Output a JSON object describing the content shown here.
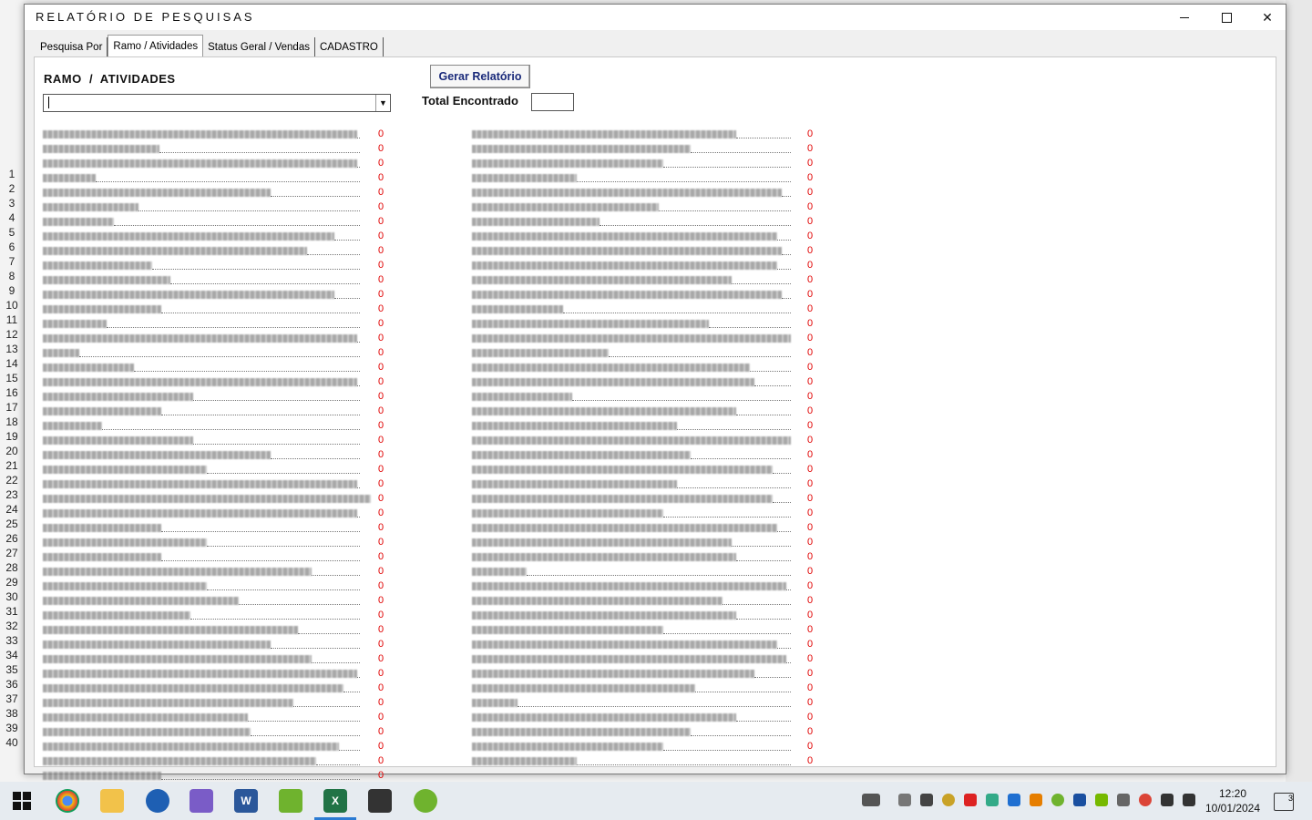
{
  "window": {
    "title": "RELATÓRIO DE PESQUISAS",
    "minimize": "—",
    "maximize": "☐",
    "close": "✕"
  },
  "tabs": [
    {
      "label": "Pesquisa Por",
      "active": false
    },
    {
      "label": "Ramo / Atividades",
      "active": true
    },
    {
      "label": "Status Geral / Vendas",
      "active": false
    },
    {
      "label": "CADASTRO",
      "active": false
    }
  ],
  "panel": {
    "heading": "RAMO  /  ATIVIDADES",
    "combo_value": "",
    "generate_button": "Gerar Relatório",
    "total_label": "Total Encontrado",
    "total_value": ""
  },
  "left_counts": [
    "0",
    "0",
    "0",
    "0",
    "0",
    "0",
    "0",
    "0",
    "0",
    "0",
    "0",
    "0",
    "0",
    "0",
    "0",
    "0",
    "0",
    "0",
    "0",
    "0",
    "0",
    "0",
    "0",
    "0",
    "0",
    "0",
    "0",
    "0",
    "0",
    "0",
    "0",
    "0",
    "0",
    "0",
    "0",
    "0",
    "0",
    "0",
    "0",
    "0",
    "0",
    "0",
    "0",
    "0",
    "0"
  ],
  "right_counts": [
    "0",
    "0",
    "0",
    "0",
    "0",
    "0",
    "0",
    "0",
    "0",
    "0",
    "0",
    "0",
    "0",
    "0",
    "0",
    "0",
    "0",
    "0",
    "0",
    "0",
    "0",
    "0",
    "0",
    "0",
    "0",
    "0",
    "0",
    "0",
    "0",
    "0",
    "0",
    "0",
    "0",
    "0",
    "0",
    "0",
    "0",
    "0",
    "0",
    "0",
    "0",
    "0",
    "0",
    "0"
  ],
  "background": {
    "row_numbers": [
      "1",
      "2",
      "3",
      "4",
      "5",
      "6",
      "7",
      "8",
      "9",
      "10",
      "11",
      "12",
      "13",
      "14",
      "15",
      "16",
      "17",
      "18",
      "19",
      "20",
      "21",
      "22",
      "23",
      "24",
      "25",
      "26",
      "27",
      "28",
      "29",
      "30",
      "31",
      "32",
      "33",
      "34",
      "35",
      "36",
      "37",
      "38",
      "39",
      "40"
    ]
  },
  "taskbar": {
    "time": "12:20",
    "date": "10/01/2024",
    "notifications": "3"
  },
  "colors": {
    "count_red": "#e00000",
    "button_text": "#1a2a7a",
    "taskbar_accent": "#2b7bd3"
  }
}
